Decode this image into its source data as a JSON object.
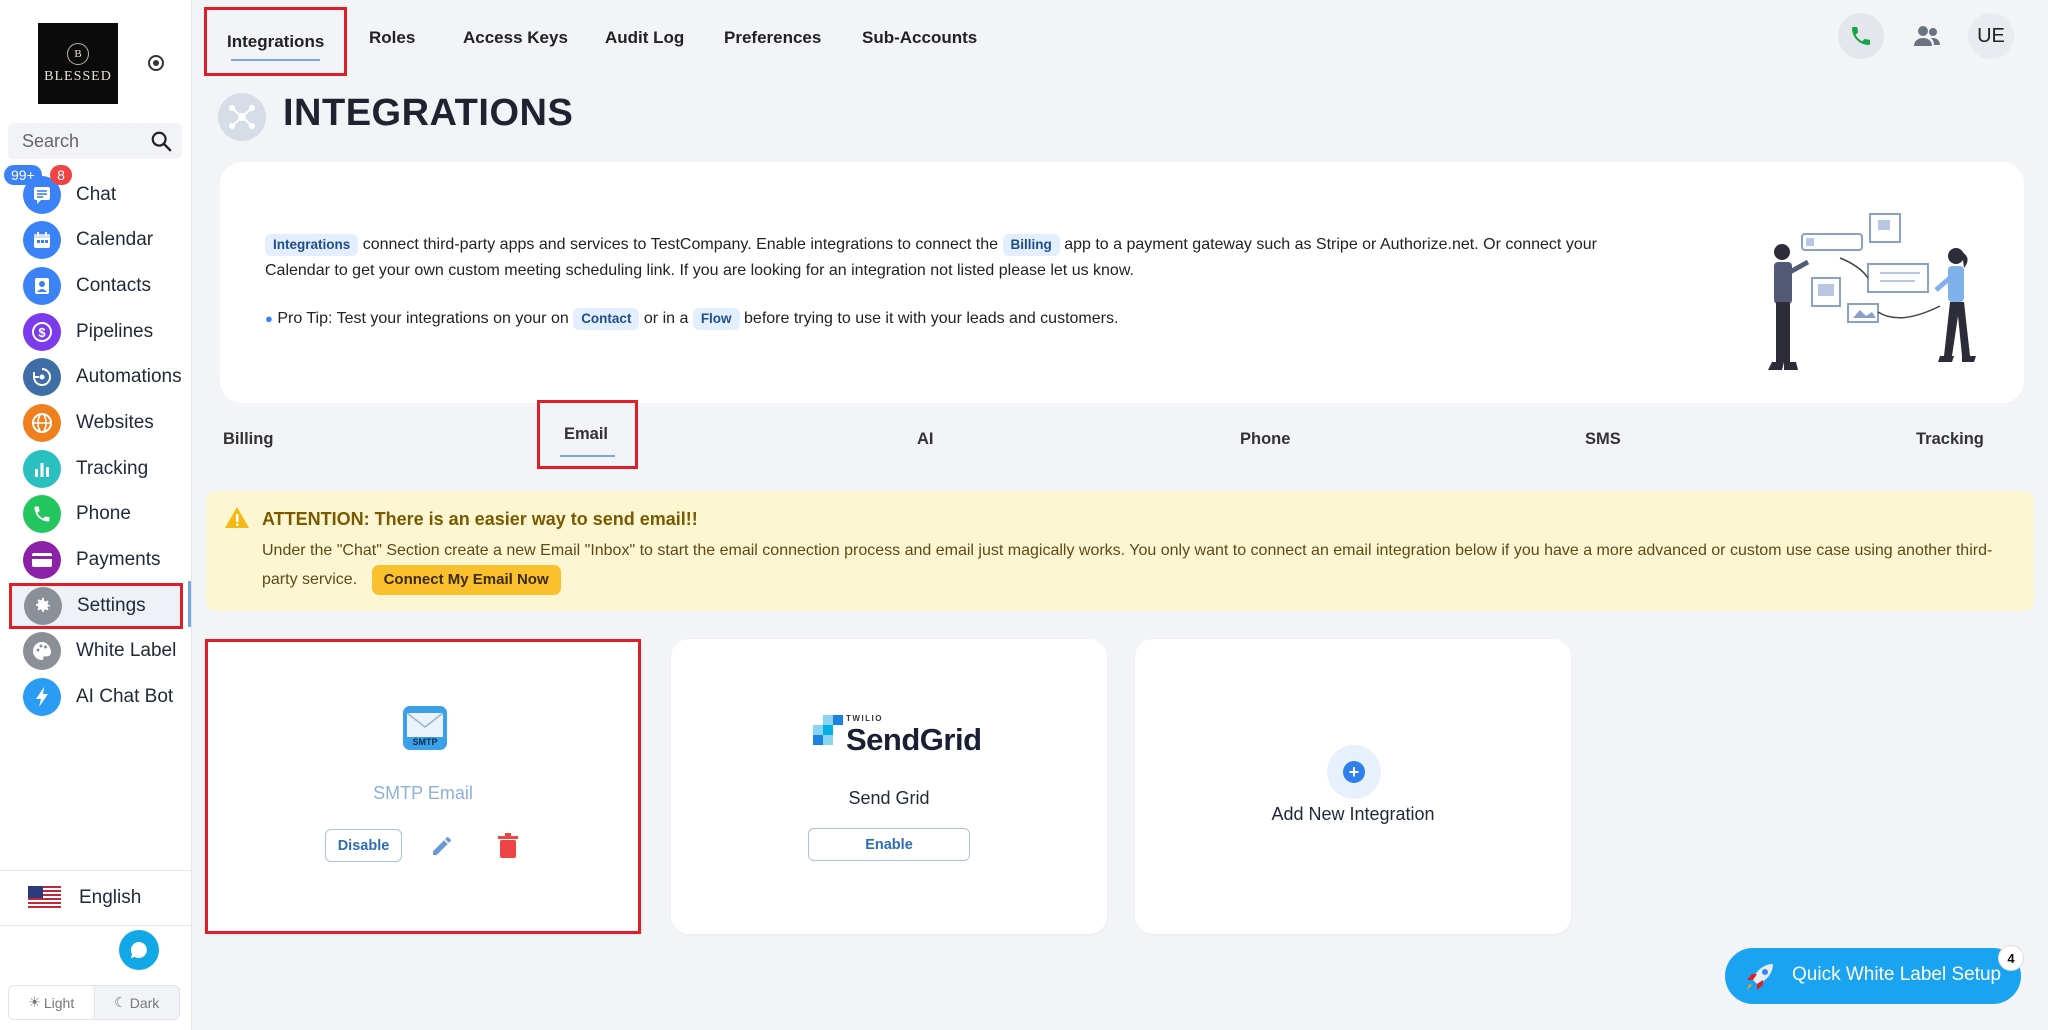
{
  "brand": {
    "logo_initial": "B",
    "logo_text": "BLESSED"
  },
  "sidebar": {
    "search_placeholder": "Search",
    "badges": {
      "chat_unread": "99+",
      "notifications": "8"
    },
    "items": [
      {
        "label": "Chat",
        "icon": "chat-icon",
        "color": "#3b82f6"
      },
      {
        "label": "Calendar",
        "icon": "calendar-icon",
        "color": "#3b82f6"
      },
      {
        "label": "Contacts",
        "icon": "contacts-icon",
        "color": "#3b82f6"
      },
      {
        "label": "Pipelines",
        "icon": "dollar-icon",
        "color": "#7c3aed"
      },
      {
        "label": "Automations",
        "icon": "automation-icon",
        "color": "#3f6ea7"
      },
      {
        "label": "Websites",
        "icon": "globe-icon",
        "color": "#f07f1d"
      },
      {
        "label": "Tracking",
        "icon": "bar-chart-icon",
        "color": "#2bc0c0"
      },
      {
        "label": "Phone",
        "icon": "phone-icon",
        "color": "#22c55e"
      },
      {
        "label": "Payments",
        "icon": "credit-card-icon",
        "color": "#8b22a8"
      },
      {
        "label": "Settings",
        "icon": "gear-icon",
        "color": "#8a8f98"
      },
      {
        "label": "White Label",
        "icon": "palette-icon",
        "color": "#8a8f98"
      },
      {
        "label": "AI Chat Bot",
        "icon": "lightning-icon",
        "color": "#2b9cf3"
      }
    ],
    "active_item": "Settings",
    "language": "English",
    "theme": {
      "light": "Light",
      "dark": "Dark"
    }
  },
  "topnav": {
    "tabs": [
      "Integrations",
      "Roles",
      "Access Keys",
      "Audit Log",
      "Preferences",
      "Sub-Accounts"
    ],
    "active_tab": "Integrations",
    "user_initials": "UE"
  },
  "page": {
    "title": "INTEGRATIONS",
    "intro": {
      "chip_integrations": "Integrations",
      "text_1": "connect third-party apps and services to TestCompany. Enable integrations to connect the",
      "chip_billing": "Billing",
      "text_2": "app to a payment gateway such as Stripe or Authorize.net. Or connect your Calendar to get your own custom meeting scheduling link. If you are looking for an integration not listed please let us know.",
      "tip_1": "Pro Tip: Test your integrations on your on",
      "chip_contact": "Contact",
      "tip_2": "or in a",
      "chip_flow": "Flow",
      "tip_3": "before trying to use it with your leads and customers."
    },
    "categories": [
      "Billing",
      "Email",
      "AI",
      "Phone",
      "SMS",
      "Tracking"
    ],
    "active_category": "Email",
    "attention": {
      "title": "ATTENTION: There is an easier way to send email!!",
      "body": "Under the \"Chat\" Section create a new Email \"Inbox\" to start the email connection process and email just magically works. You only want to connect an email integration below if you have a more advanced or custom use case using another third-party service.",
      "button": "Connect My Email Now"
    },
    "cards": {
      "smtp": {
        "name": "SMTP Email",
        "icon_label": "SMTP",
        "disable_button": "Disable"
      },
      "sendgrid": {
        "brand_small": "TWILIO",
        "brand_word": "SendGrid",
        "name": "Send Grid",
        "enable_button": "Enable"
      },
      "add": {
        "label": "Add New Integration",
        "plus": "+"
      }
    },
    "quick_setup": {
      "label": "Quick White Label Setup",
      "count": "4"
    }
  },
  "colors": {
    "accent": "#1aa3f0",
    "highlight_box": "#e11d28",
    "attention_bg": "#fdf6d2"
  }
}
